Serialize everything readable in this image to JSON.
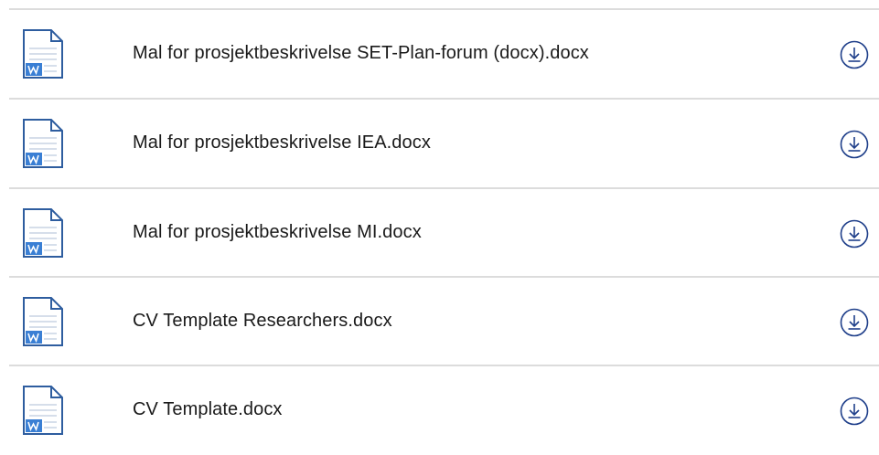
{
  "files": [
    {
      "name": "Mal for prosjektbeskrivelse SET-Plan-forum (docx).docx",
      "icon": "word-document-icon",
      "action_icon": "download-icon"
    },
    {
      "name": "Mal for prosjektbeskrivelse IEA.docx",
      "icon": "word-document-icon",
      "action_icon": "download-icon"
    },
    {
      "name": "Mal for prosjektbeskrivelse MI.docx",
      "icon": "word-document-icon",
      "action_icon": "download-icon"
    },
    {
      "name": "CV Template Researchers.docx",
      "icon": "word-document-icon",
      "action_icon": "download-icon"
    },
    {
      "name": "CV Template.docx",
      "icon": "word-document-icon",
      "action_icon": "download-icon"
    }
  ],
  "colors": {
    "divider": "#dcdcdc",
    "doc_border": "#2e5d9f",
    "word_badge": "#3a7fd4",
    "download_icon": "#1f3f8a",
    "text": "#1a1a1a"
  }
}
